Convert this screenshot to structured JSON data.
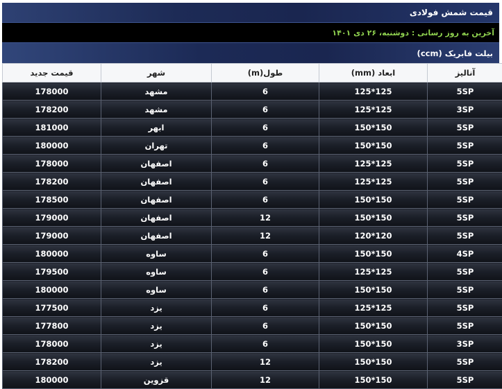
{
  "header": {
    "title": "قیمت شمش فولادی"
  },
  "update_line": "آخرین به روز رسانی : دوشنبه، ۲۶ دی ۱۴۰۱",
  "section_title": "بیلت فابریک (ccm)",
  "table": {
    "columns": [
      "آنالیز",
      "ابعاد (mm)",
      "طول(m)",
      "شهر",
      "قیمت جدید"
    ],
    "rows": [
      [
        "5SP",
        "125*125",
        "6",
        "مشهد",
        "178000"
      ],
      [
        "3SP",
        "125*125",
        "6",
        "مشهد",
        "178200"
      ],
      [
        "5SP",
        "150*150",
        "6",
        "ابهر",
        "181000"
      ],
      [
        "5SP",
        "150*150",
        "6",
        "تهران",
        "180000"
      ],
      [
        "5SP",
        "125*125",
        "6",
        "اصفهان",
        "178000"
      ],
      [
        "5SP",
        "125*125",
        "6",
        "اصفهان",
        "178200"
      ],
      [
        "5SP",
        "150*150",
        "6",
        "اصفهان",
        "178500"
      ],
      [
        "5SP",
        "150*150",
        "12",
        "اصفهان",
        "179000"
      ],
      [
        "5SP",
        "120*120",
        "12",
        "اصفهان",
        "179000"
      ],
      [
        "4SP",
        "150*150",
        "6",
        "ساوه",
        "180000"
      ],
      [
        "5SP",
        "125*125",
        "6",
        "ساوه",
        "179500"
      ],
      [
        "5SP",
        "150*150",
        "6",
        "ساوه",
        "180000"
      ],
      [
        "5SP",
        "125*125",
        "6",
        "یزد",
        "177500"
      ],
      [
        "5SP",
        "150*150",
        "6",
        "یزد",
        "177800"
      ],
      [
        "3SP",
        "150*150",
        "6",
        "یزد",
        "178000"
      ],
      [
        "5SP",
        "150*150",
        "12",
        "یزد",
        "178200"
      ],
      [
        "5SP",
        "150*150",
        "12",
        "قزوین",
        "180000"
      ]
    ]
  },
  "colors": {
    "title_bar": "#1d2b56",
    "update_bar_bg": "#000000",
    "update_text": "#8fd14f",
    "row_dark": "#1b1f28",
    "header_row_bg": "#f6f7f9"
  }
}
